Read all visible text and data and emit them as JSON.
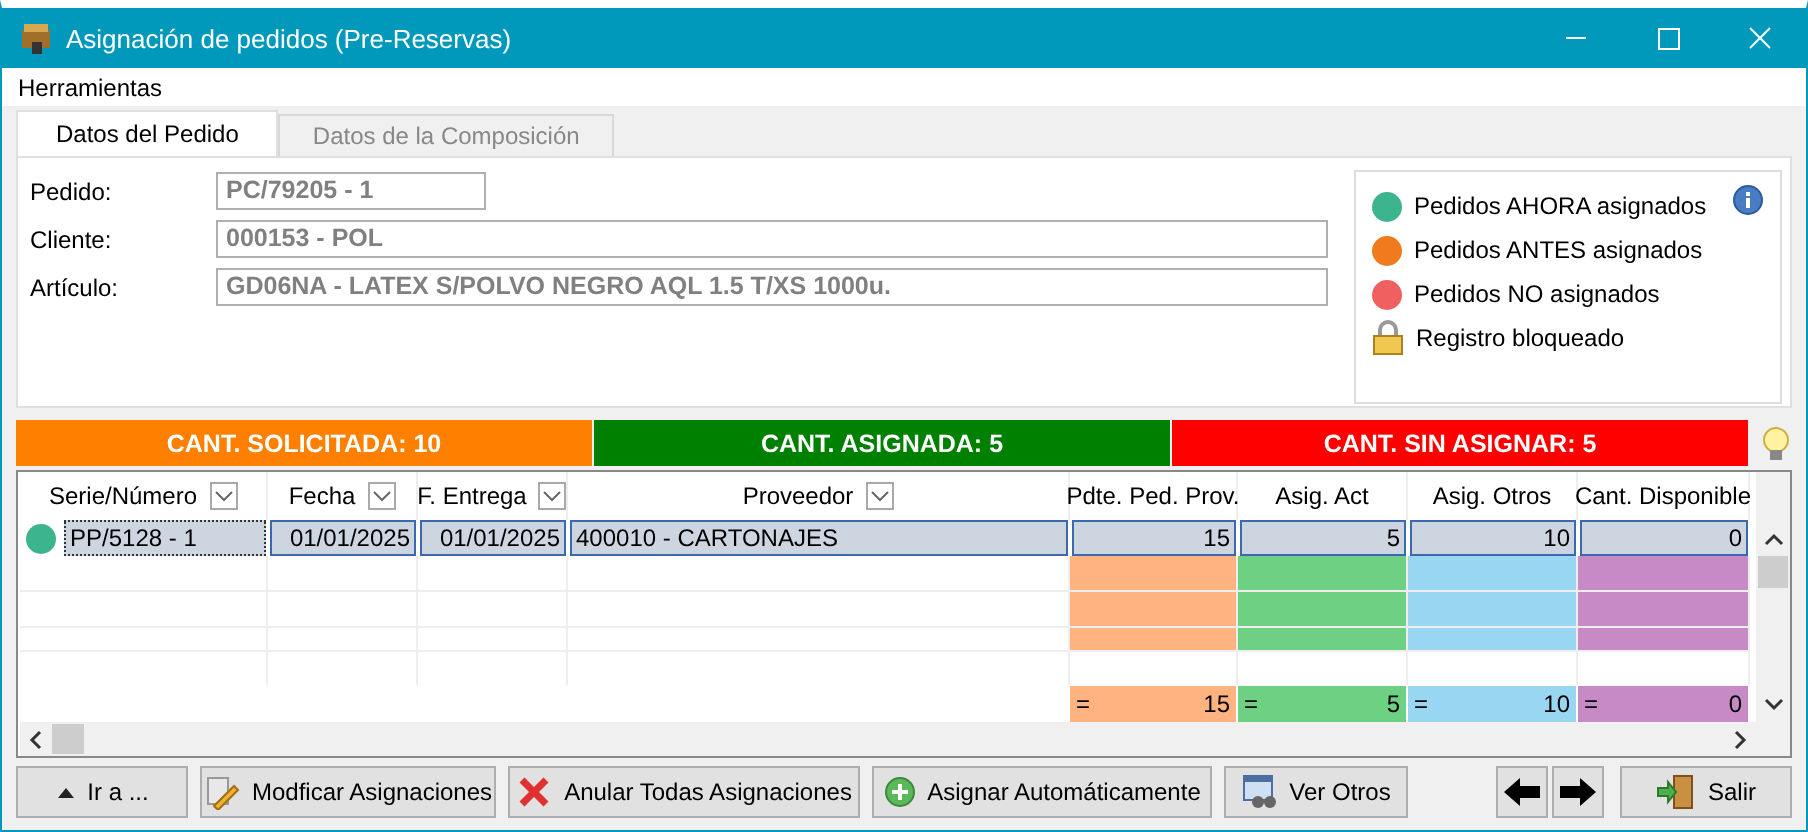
{
  "window": {
    "title": "Asignación de pedidos (Pre-Reservas)"
  },
  "menu": [
    "Herramientas"
  ],
  "tabs": [
    {
      "label": "Datos del Pedido",
      "selected": true
    },
    {
      "label": "Datos de la Composición",
      "selected": false
    }
  ],
  "fields": [
    {
      "label": "Pedido:",
      "value": "PC/79205 - 1"
    },
    {
      "label": "Cliente:",
      "value": "000153 - POL"
    },
    {
      "label": "Artículo:",
      "value": "GD06NA - LATEX S/POLVO NEGRO AQL 1.5 T/XS 1000u."
    }
  ],
  "legend": [
    {
      "kind": "dot",
      "label": "Pedidos AHORA asignados",
      "color": "#3cb58f"
    },
    {
      "kind": "dot",
      "label": "Pedidos ANTES asignados",
      "color": "#f07b1e"
    },
    {
      "kind": "dot",
      "label": "Pedidos NO asignados",
      "color": "#f06060"
    },
    {
      "kind": "lock",
      "label": "Registro bloqueado"
    }
  ],
  "summary": [
    {
      "label": "CANT. SOLICITADA: 10",
      "color": "#ff8000"
    },
    {
      "label": "CANT. ASIGNADA: 5",
      "color": "#008000"
    },
    {
      "label": "CANT. SIN ASIGNAR: 5",
      "color": "#ff0000"
    }
  ],
  "table": {
    "columns": [
      {
        "label": "Serie/Número",
        "filter": true
      },
      {
        "label": "Fecha",
        "filter": true
      },
      {
        "label": "F. Entrega",
        "filter": true
      },
      {
        "label": "Proveedor",
        "filter": true
      },
      {
        "label": "Pdte. Ped. Prov.",
        "filter": false,
        "color": "#ffb380"
      },
      {
        "label": "Asig. Act",
        "filter": false,
        "color": "#6dd082"
      },
      {
        "label": "Asig. Otros",
        "filter": false,
        "color": "#99d6f2"
      },
      {
        "label": "Cant. Disponible",
        "filter": false,
        "color": "#c78ac7"
      }
    ],
    "rows": [
      {
        "selected": true,
        "color": "#3cb58f",
        "cells": [
          "PP/5128 - 1",
          "01/01/2025",
          "01/01/2025",
          "400010 - CARTONAJES",
          "15",
          "5",
          "10",
          "0"
        ]
      }
    ],
    "totals": [
      {
        "sign": "=",
        "value": "15"
      },
      {
        "sign": "=",
        "value": "5"
      },
      {
        "sign": "=",
        "value": "10"
      },
      {
        "sign": "=",
        "value": "0"
      }
    ]
  },
  "buttons": [
    {
      "kind": "up",
      "label": "Ir a ..."
    },
    {
      "kind": "edit",
      "label": "Modficar Asignaciones"
    },
    {
      "kind": "cancel",
      "label": "Anular Todas Asignaciones"
    },
    {
      "kind": "add",
      "label": "Asignar Automáticamente"
    },
    {
      "kind": "view",
      "label": "Ver Otros"
    }
  ],
  "nav_buttons": [
    {
      "kind": "left"
    },
    {
      "kind": "right"
    }
  ],
  "exit_button": {
    "label": "Salir"
  }
}
